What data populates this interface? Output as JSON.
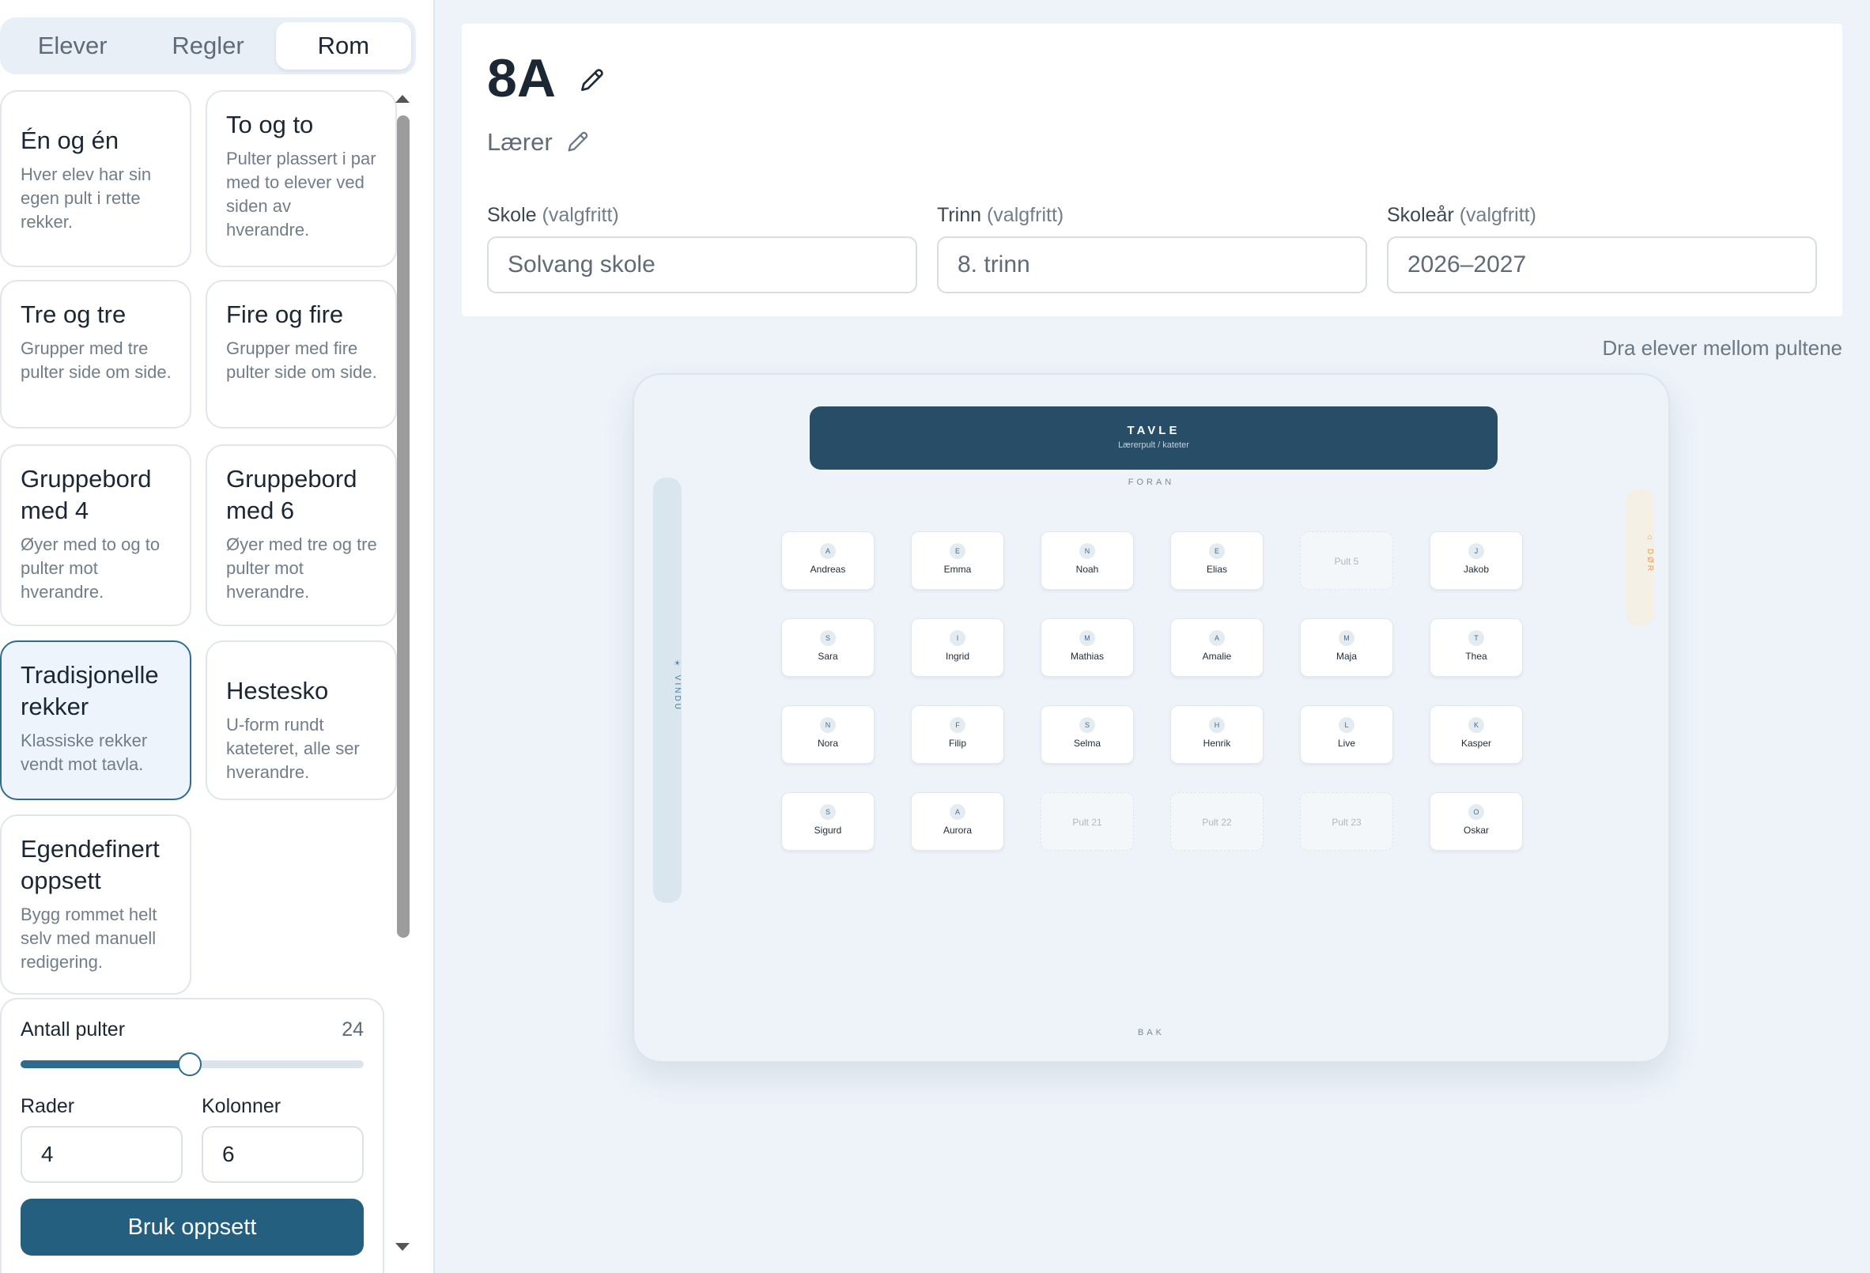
{
  "tabs": [
    "Elever",
    "Regler",
    "Rom"
  ],
  "layouts": [
    {
      "title": "Én og én",
      "desc": "Hver elev har sin egen pult i rette rekker."
    },
    {
      "title": "To og to",
      "desc": "Pulter plassert i par med to elever ved siden av hverandre."
    },
    {
      "title": "Tre og tre",
      "desc": "Grupper med tre pulter side om side."
    },
    {
      "title": "Fire og fire",
      "desc": "Grupper med fire pulter side om side."
    },
    {
      "title": "Gruppebord med 4",
      "desc": "Øyer med to og to pulter mot hverandre."
    },
    {
      "title": "Gruppebord med 6",
      "desc": "Øyer med tre og tre pulter mot hverandre."
    },
    {
      "title": "Tradisjonelle rekker",
      "desc": "Klassiske rekker vendt mot tavla."
    },
    {
      "title": "Hestesko",
      "desc": "U-form rundt kateteret, alle ser hverandre."
    },
    {
      "title": "Egendefinert oppsett",
      "desc": "Bygg rommet helt selv med manuell redigering."
    }
  ],
  "config": {
    "desk_count_label": "Antall pulter",
    "desk_count": "24",
    "slider_fraction": 0.49,
    "rows_label": "Rader",
    "rows": "4",
    "cols_label": "Kolonner",
    "cols": "6",
    "apply_label": "Bruk oppsett"
  },
  "header": {
    "class_name": "8A",
    "teacher": "Lærer",
    "fields": [
      {
        "label": "Skole",
        "optional": "(valgfritt)",
        "value": "Solvang skole"
      },
      {
        "label": "Trinn",
        "optional": "(valgfritt)",
        "value": "8. trinn"
      },
      {
        "label": "Skoleår",
        "optional": "(valgfritt)",
        "value": "2026–2027"
      }
    ]
  },
  "hint": "Dra elever mellom pultene",
  "room": {
    "board_title": "TAVLE",
    "board_subtitle": "Lærerpult / kateter",
    "front": "FORAN",
    "back": "BAK",
    "window": "VINDU",
    "door": "DØR",
    "desks": [
      {
        "initial": "A",
        "name": "Andreas"
      },
      {
        "initial": "E",
        "name": "Emma"
      },
      {
        "initial": "N",
        "name": "Noah"
      },
      {
        "initial": "E",
        "name": "Elias"
      },
      {
        "empty": "Pult 5"
      },
      {
        "initial": "J",
        "name": "Jakob"
      },
      {
        "initial": "S",
        "name": "Sara"
      },
      {
        "initial": "I",
        "name": "Ingrid"
      },
      {
        "initial": "M",
        "name": "Mathias"
      },
      {
        "initial": "A",
        "name": "Amalie"
      },
      {
        "initial": "M",
        "name": "Maja"
      },
      {
        "initial": "T",
        "name": "Thea"
      },
      {
        "initial": "N",
        "name": "Nora"
      },
      {
        "initial": "F",
        "name": "Filip"
      },
      {
        "initial": "S",
        "name": "Selma"
      },
      {
        "initial": "H",
        "name": "Henrik"
      },
      {
        "initial": "L",
        "name": "Live"
      },
      {
        "initial": "K",
        "name": "Kasper"
      },
      {
        "initial": "S",
        "name": "Sigurd"
      },
      {
        "initial": "A",
        "name": "Aurora"
      },
      {
        "empty": "Pult 21"
      },
      {
        "empty": "Pult 22"
      },
      {
        "empty": "Pult 23"
      },
      {
        "initial": "O",
        "name": "Oskar"
      }
    ]
  },
  "colors": {
    "accent": "#245f80",
    "board": "#274e66",
    "selected_card_border": "#2f6c8e",
    "door": "#e89c4c"
  }
}
